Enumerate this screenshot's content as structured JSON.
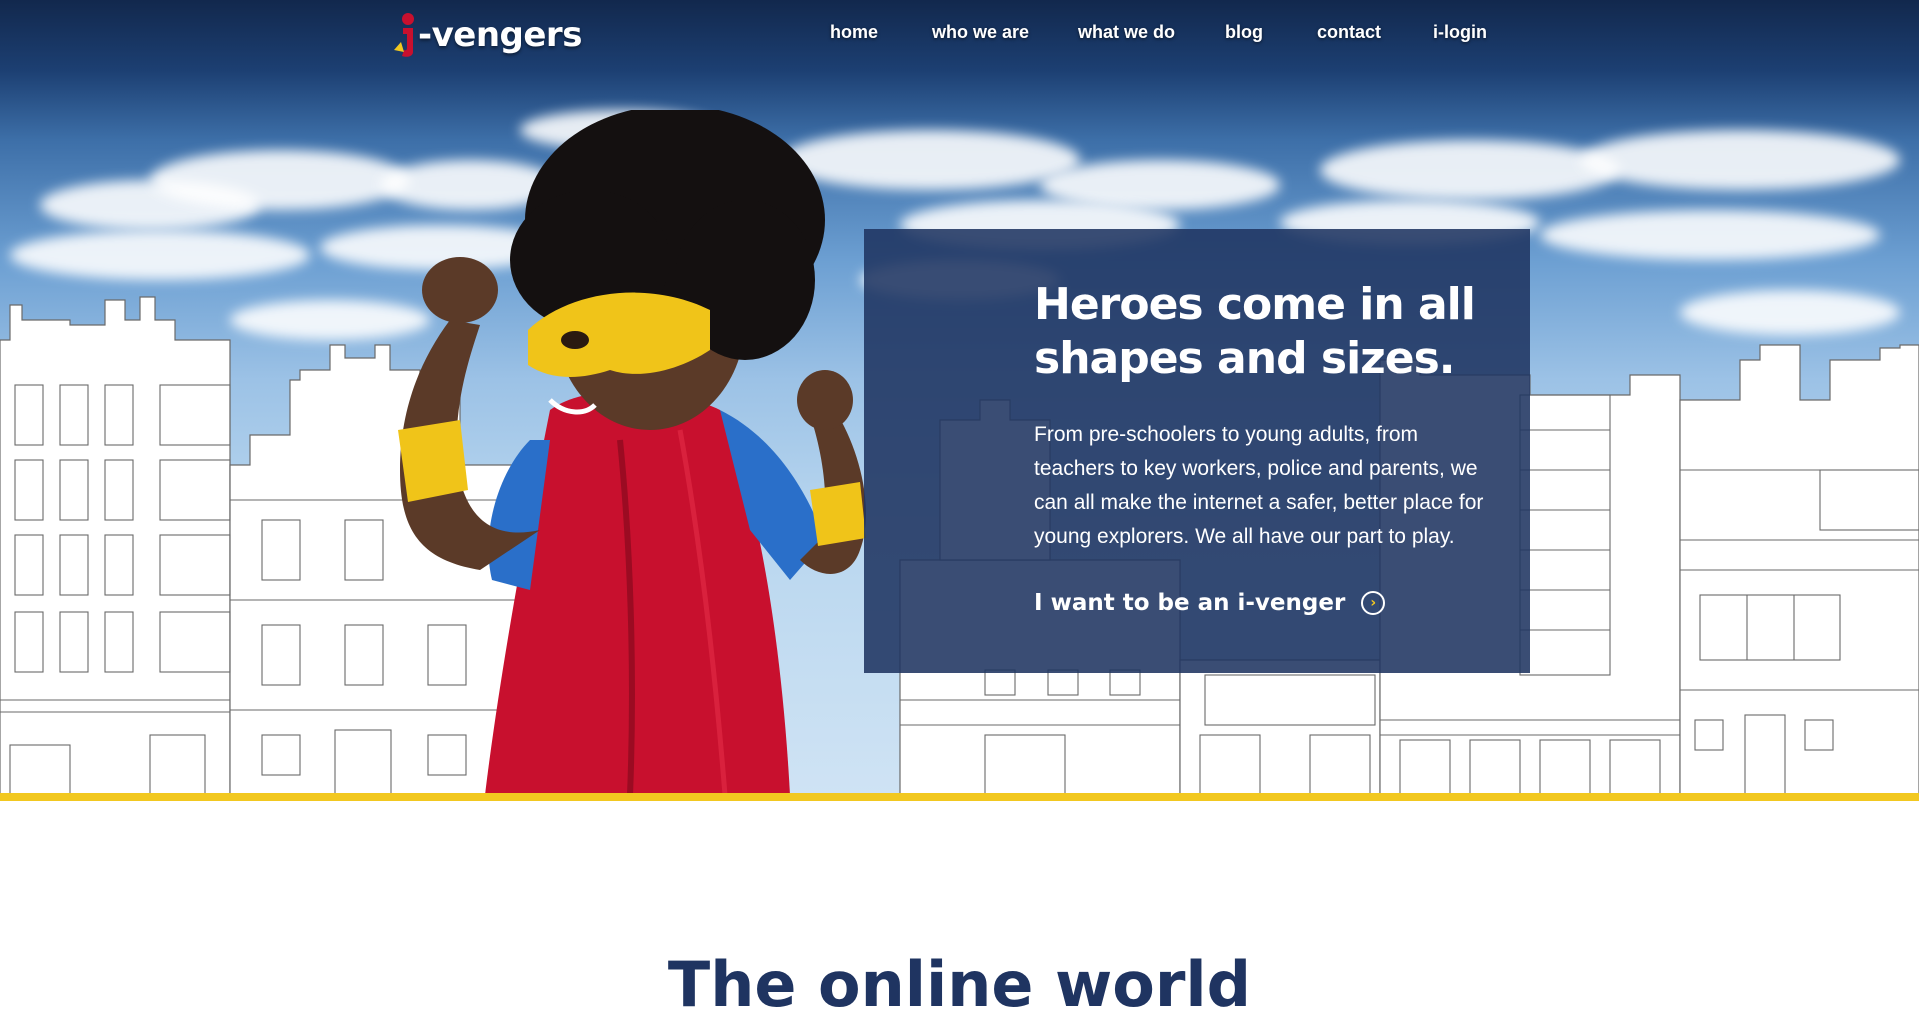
{
  "brand": {
    "logo_text": "-vengers",
    "logo_mark_icon": "i-letter-mark-icon",
    "colors": {
      "navy": "#1f3461",
      "yellow": "#f2c820",
      "red": "#c8102e"
    }
  },
  "nav": {
    "items": [
      {
        "label": "home"
      },
      {
        "label": "who we are"
      },
      {
        "label": "what we do"
      },
      {
        "label": "blog"
      },
      {
        "label": "contact"
      },
      {
        "label": "i-login"
      }
    ]
  },
  "hero": {
    "title": "Heroes come in all shapes and sizes.",
    "text": "From pre-schoolers to young adults, from teachers to key workers, police and parents, we can all make the internet a safer, better place for young explorers. We all have our part to play.",
    "cta_label": "I want to be an i-venger",
    "cta_icon": "chevron-right-circle-icon",
    "image": "child-superhero-photo"
  },
  "section": {
    "heading": "The online world"
  }
}
